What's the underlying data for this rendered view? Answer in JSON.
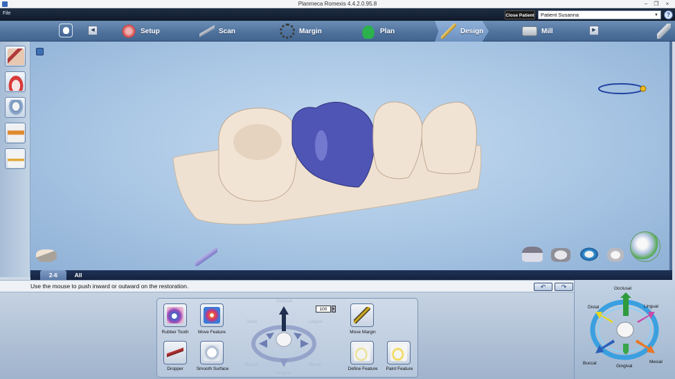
{
  "window": {
    "title": "Planmeca Romexis 4.4.2.0.95.8",
    "minimize": "–",
    "restore": "❐",
    "close": "×"
  },
  "menu": {
    "file": "File"
  },
  "patient": {
    "close_label": "Close Patient",
    "selected": "Patient Susanna",
    "help": "?"
  },
  "workflow": {
    "steps": [
      {
        "label": "Setup",
        "icon": "gum-icon"
      },
      {
        "label": "Scan",
        "icon": "scanner-wand-icon"
      },
      {
        "label": "Margin",
        "icon": "margin-ring-icon"
      },
      {
        "label": "Plan",
        "icon": "tooth-plan-icon"
      },
      {
        "label": "Design",
        "icon": "pencil-icon",
        "active": true
      },
      {
        "label": "Mill",
        "icon": "milling-unit-icon"
      }
    ],
    "prev": "◀",
    "next": "▶"
  },
  "tabs": [
    {
      "label": "2-6",
      "active": true
    },
    {
      "label": "All",
      "active": false
    }
  ],
  "status": {
    "message": "Use the mouse to push inward or outward on the restoration."
  },
  "history": {
    "undo": "↶",
    "redo": "↷"
  },
  "tools": {
    "rubber_tooth": "Rubber Tooth",
    "move_feature": "Move Feature",
    "dropper": "Dropper",
    "smooth_surface": "Smooth Surface",
    "move_margin": "Move Margin",
    "define_feature": "Define Feature",
    "paint_feature": "Paint Feature",
    "strength": "100",
    "spin": "▸",
    "ghost_labels": {
      "occlusal": "Occlusal",
      "distal": "Distal",
      "lingual": "Lingual",
      "buccal": "Buccal",
      "mesial": "Mesial",
      "gingival": "Gingival"
    }
  },
  "orientation": {
    "occlusal": "Occlusal",
    "distal": "Distal",
    "lingual": "Lingual",
    "buccal": "Buccal",
    "gingival": "Gingival",
    "mesial": "Mesial"
  },
  "colors": {
    "crown": "#4f55b5",
    "model": "#efe0cf",
    "viewport": "#a9c6e4",
    "occlusal_arrow": "#2e9b3d",
    "distal_arrow": "#e6d822",
    "lingual_arrow": "#c84aa8",
    "buccal_arrow": "#2c5fb8",
    "mesial_arrow": "#e8782a",
    "gingival_arrow": "#3aa54a"
  }
}
